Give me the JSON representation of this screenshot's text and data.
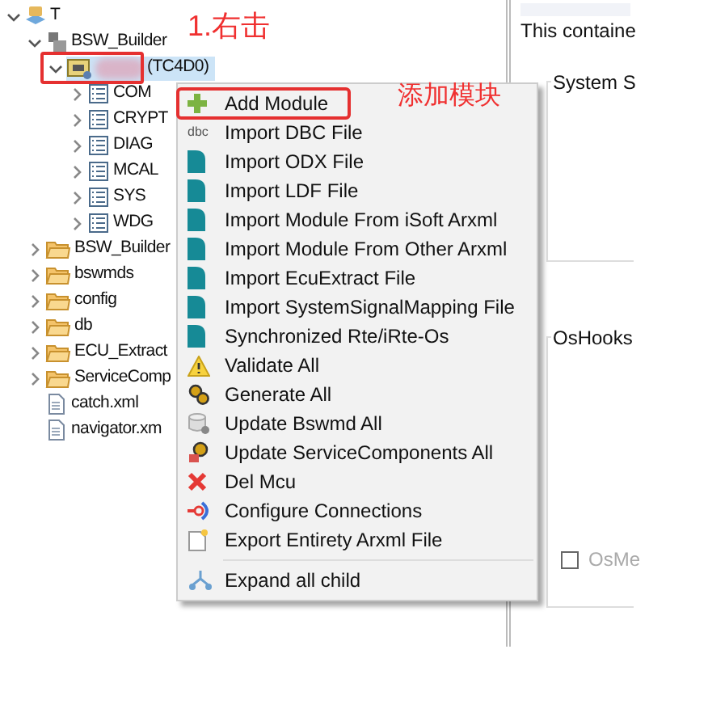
{
  "tree": [
    {
      "label": "T",
      "kind": "project",
      "expanded": true,
      "selected": false,
      "children": [
        {
          "label": "BSW_Builder",
          "kind": "package",
          "expanded": true,
          "selected": false,
          "children": [
            {
              "label": "(TC4D0)",
              "kind": "ecu",
              "expanded": true,
              "selected": true,
              "redacted": true,
              "children": [
                {
                  "label": "COM",
                  "kind": "list",
                  "expanded": false,
                  "selected": false
                },
                {
                  "label": "CRYPT",
                  "kind": "list",
                  "expanded": false,
                  "selected": false
                },
                {
                  "label": "DIAG",
                  "kind": "list",
                  "expanded": false,
                  "selected": false
                },
                {
                  "label": "MCAL",
                  "kind": "list",
                  "expanded": false,
                  "selected": false
                },
                {
                  "label": "SYS",
                  "kind": "list",
                  "expanded": false,
                  "selected": false
                },
                {
                  "label": "WDG",
                  "kind": "list",
                  "expanded": false,
                  "selected": false
                }
              ]
            }
          ]
        },
        {
          "label": "BSW_Builder",
          "kind": "folder",
          "expanded": false,
          "selected": false
        },
        {
          "label": "bswmds",
          "kind": "folder",
          "expanded": false,
          "selected": false
        },
        {
          "label": "config",
          "kind": "folder",
          "expanded": false,
          "selected": false
        },
        {
          "label": "db",
          "kind": "folder",
          "expanded": false,
          "selected": false
        },
        {
          "label": "ECU_Extract",
          "kind": "folder",
          "expanded": false,
          "selected": false
        },
        {
          "label": "ServiceComp",
          "kind": "folder",
          "expanded": false,
          "selected": false
        },
        {
          "label": "catch.xml",
          "kind": "file",
          "selected": false
        },
        {
          "label": "navigator.xm",
          "kind": "file",
          "selected": false
        }
      ]
    }
  ],
  "annotations": [
    {
      "text": "1.右击"
    },
    {
      "text": "添加模块"
    }
  ],
  "context_menu": {
    "items": [
      {
        "kind": "plus",
        "label": "Add Module",
        "highlighted": true
      },
      {
        "kind": "dbc",
        "label": "Import DBC File",
        "icon_text": "dbc",
        "highlighted": false
      },
      {
        "kind": "import",
        "label": "Import ODX File",
        "highlighted": false
      },
      {
        "kind": "import",
        "label": "Import LDF File",
        "highlighted": false
      },
      {
        "kind": "import",
        "label": "Import Module From iSoft Arxml",
        "highlighted": false
      },
      {
        "kind": "import",
        "label": "Import Module From Other Arxml",
        "highlighted": false
      },
      {
        "kind": "import",
        "label": "Import EcuExtract File",
        "highlighted": false
      },
      {
        "kind": "import",
        "label": "Import SystemSignalMapping File",
        "highlighted": false
      },
      {
        "kind": "import",
        "label": "Synchronized Rte/iRte-Os",
        "highlighted": false
      },
      {
        "kind": "warning",
        "label": "Validate All",
        "highlighted": false
      },
      {
        "kind": "gears",
        "label": "Generate All",
        "highlighted": false
      },
      {
        "kind": "database",
        "label": "Update Bswmd All",
        "highlighted": false
      },
      {
        "kind": "gearbox",
        "label": "Update ServiceComponents All",
        "highlighted": false
      },
      {
        "kind": "delete",
        "label": "Del Mcu",
        "highlighted": false
      },
      {
        "kind": "connect",
        "label": "Configure Connections",
        "highlighted": false
      },
      {
        "kind": "export",
        "label": "Export Entirety Arxml File",
        "highlighted": false
      },
      {
        "kind": "separator"
      },
      {
        "kind": "expand",
        "label": "Expand all child",
        "highlighted": false
      }
    ]
  },
  "editor": {
    "description": "This containe",
    "groups": [
      {
        "title": "System S"
      },
      {
        "title": "OsHooks",
        "checkbox": {
          "label": "OsMe",
          "checked": false,
          "disabled": true
        }
      }
    ]
  }
}
